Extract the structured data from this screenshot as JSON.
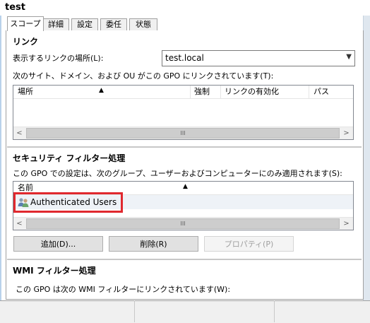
{
  "window": {
    "title": "test"
  },
  "tabs": [
    {
      "label": "スコープ",
      "active": true
    },
    {
      "label": "詳細",
      "active": false
    },
    {
      "label": "設定",
      "active": false
    },
    {
      "label": "委任",
      "active": false
    },
    {
      "label": "状態",
      "active": false
    }
  ],
  "links": {
    "section_title": "リンク",
    "location_label": "表示するリンクの場所(L):",
    "location_value": "test.local",
    "description": "次のサイト、ドメイン、および OU がこの GPO にリンクされています(T):",
    "columns": [
      "場所",
      "強制",
      "リンクの有効化",
      "パス"
    ],
    "rows": []
  },
  "security": {
    "section_title": "セキュリティ フィルター処理",
    "description": "この GPO での設定は、次のグループ、ユーザーおよびコンピューターにのみ適用されます(S):",
    "columns": [
      "名前"
    ],
    "rows": [
      {
        "name": "Authenticated Users",
        "icon": "users-group-icon"
      }
    ],
    "buttons": {
      "add": "追加(D)...",
      "remove": "削除(R)",
      "properties": "プロパティ(P)"
    }
  },
  "wmi": {
    "section_title": "WMI フィルター処理",
    "description": "この GPO は次の WMI フィルターにリンクされています(W):"
  },
  "colors": {
    "highlight": "#e0282e",
    "frame": "#b9d1ea"
  }
}
